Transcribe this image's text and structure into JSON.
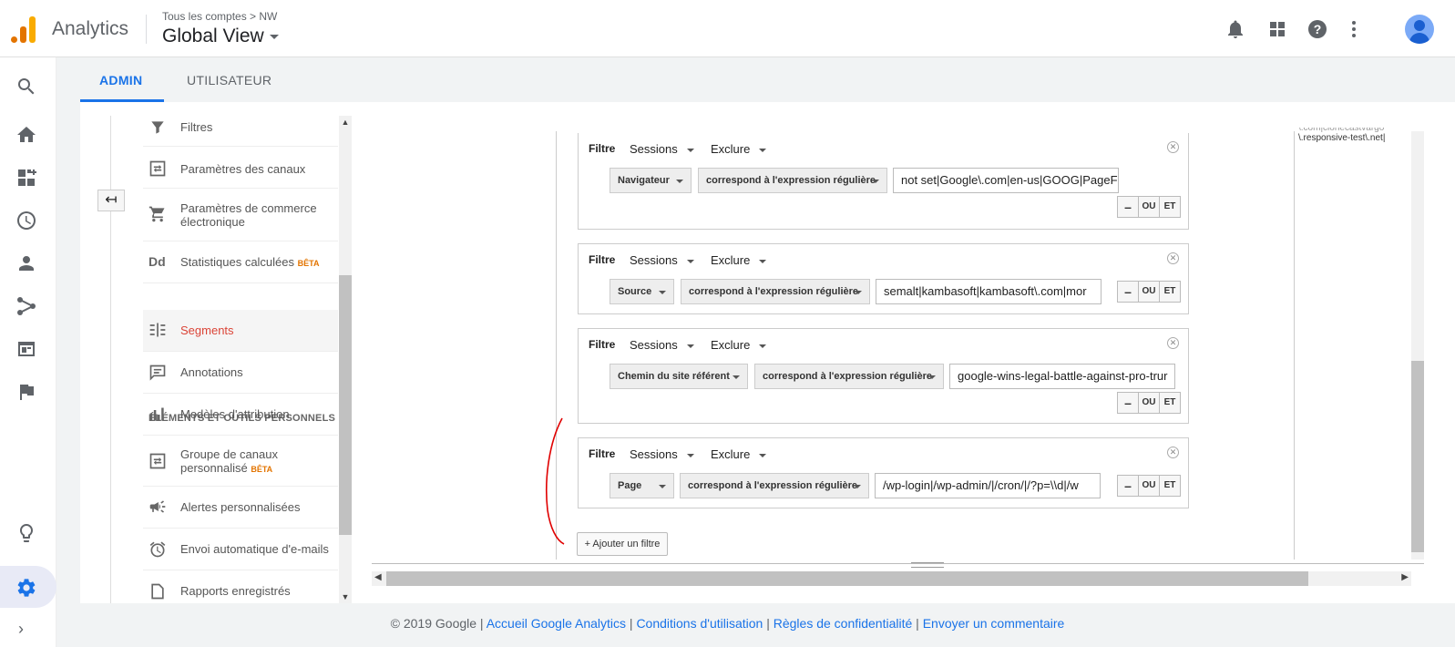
{
  "app": {
    "name": "Analytics",
    "breadcrumb": "Tous les comptes > NW",
    "view": "Global View"
  },
  "tabs": [
    {
      "label": "ADMIN"
    },
    {
      "label": "UTILISATEUR"
    }
  ],
  "menu": {
    "items": [
      {
        "label": "Filtres"
      },
      {
        "label": "Paramètres des canaux"
      },
      {
        "label": "Paramètres de commerce électronique"
      },
      {
        "label": "Statistiques calculées",
        "badge": "BÊTA"
      },
      {
        "label": "Segments"
      },
      {
        "label": "Annotations"
      },
      {
        "label": "Modèles d'attribution"
      },
      {
        "label": "Groupe de canaux personnalisé",
        "badge": "BÊTA"
      },
      {
        "label": "Alertes personnalisées"
      },
      {
        "label": "Envoi automatique d'e-mails"
      },
      {
        "label": "Rapports enregistrés"
      }
    ],
    "section_header": "ÉLÉMENTS ET OUTILS PERSONNELS",
    "dd_icon_text": "Dd"
  },
  "filters": [
    {
      "label": "Filtre",
      "scope": "Sessions",
      "mode": "Exclure",
      "dimension": "Navigateur",
      "operator": "correspond à l'expression régulière",
      "value": "not set|Google\\.com|en-us|GOOG|PageF"
    },
    {
      "label": "Filtre",
      "scope": "Sessions",
      "mode": "Exclure",
      "dimension": "Source",
      "operator": "correspond à l'expression régulière",
      "value": "semalt|kambasoft|kambasoft\\.com|mor"
    },
    {
      "label": "Filtre",
      "scope": "Sessions",
      "mode": "Exclure",
      "dimension": "Chemin du site référent",
      "operator": "correspond à l'expression régulière",
      "value": "google-wins-legal-battle-against-pro-trur"
    },
    {
      "label": "Filtre",
      "scope": "Sessions",
      "mode": "Exclure",
      "dimension": "Page",
      "operator": "correspond à l'expression régulière",
      "value": "/wp-login|/wp-admin/|/cron/|/?p=\\\\d|/w"
    }
  ],
  "filter_buttons": {
    "minus": "–",
    "or": "OU",
    "and": "ET"
  },
  "add_filter": "+ Ajouter un filtre",
  "right_snippet": {
    "line1": "\\.com|clonecastvargo",
    "line2": "\\.responsive-test\\.net|"
  },
  "footer": {
    "copyright": "© 2019 Google |",
    "links": [
      "Accueil Google Analytics",
      "Conditions d'utilisation",
      "Règles de confidentialité",
      "Envoyer un commentaire"
    ],
    "sep": "|"
  },
  "colors": {
    "accent": "#1a73e8",
    "selected_menu": "#db4437",
    "beta": "#e37400",
    "annotation": "#e00000"
  }
}
